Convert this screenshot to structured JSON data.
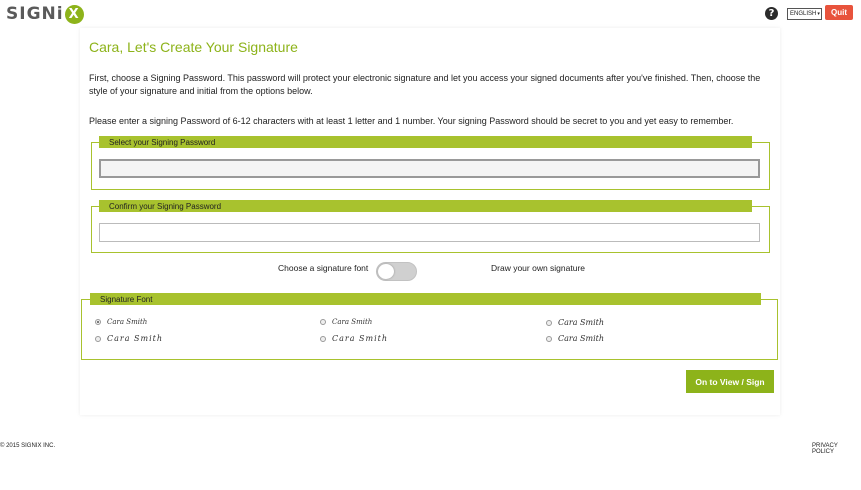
{
  "header": {
    "logo_text": "SIGN",
    "logo_x": "X",
    "help_symbol": "?",
    "language": "ENGLISH",
    "quit_label": "Quit"
  },
  "main": {
    "title": "Cara, Let's Create Your Signature",
    "intro": "First, choose a Signing Password. This password will protect your electronic signature and let you access your signed documents after you've finished. Then, choose the style of your signature and initial from the options below.",
    "instruction": "Please enter a signing Password of 6-12 characters with at least 1 letter and 1 number. Your signing Password should be secret to you and yet easy to remember.",
    "password_legend": "Select your Signing Password",
    "password_value": "",
    "confirm_legend": "Confirm your Signing Password",
    "confirm_value": "",
    "toggle_left_label": "Choose a signature font",
    "toggle_right_label": "Draw your own signature",
    "toggle_on": false,
    "font_legend": "Signature Font",
    "font_options": [
      {
        "label": "Cara Smith",
        "selected": true
      },
      {
        "label": "Cara Smith",
        "selected": false
      },
      {
        "label": "Cara Smith",
        "selected": false
      },
      {
        "label": "Cara Smith",
        "selected": false
      },
      {
        "label": "Cara Smith",
        "selected": false
      },
      {
        "label": "Cara Smith",
        "selected": false
      }
    ],
    "next_button": "On to View / Sign"
  },
  "footer": {
    "copyright": "© 2015 SIGNIX INC.",
    "privacy": "PRIVACY POLICY"
  },
  "colors": {
    "accent": "#8db31a",
    "legend": "#a8c22e",
    "quit": "#e8533c"
  },
  "icons": [
    "help-icon",
    "chevron-down-icon",
    "radio-icon"
  ]
}
